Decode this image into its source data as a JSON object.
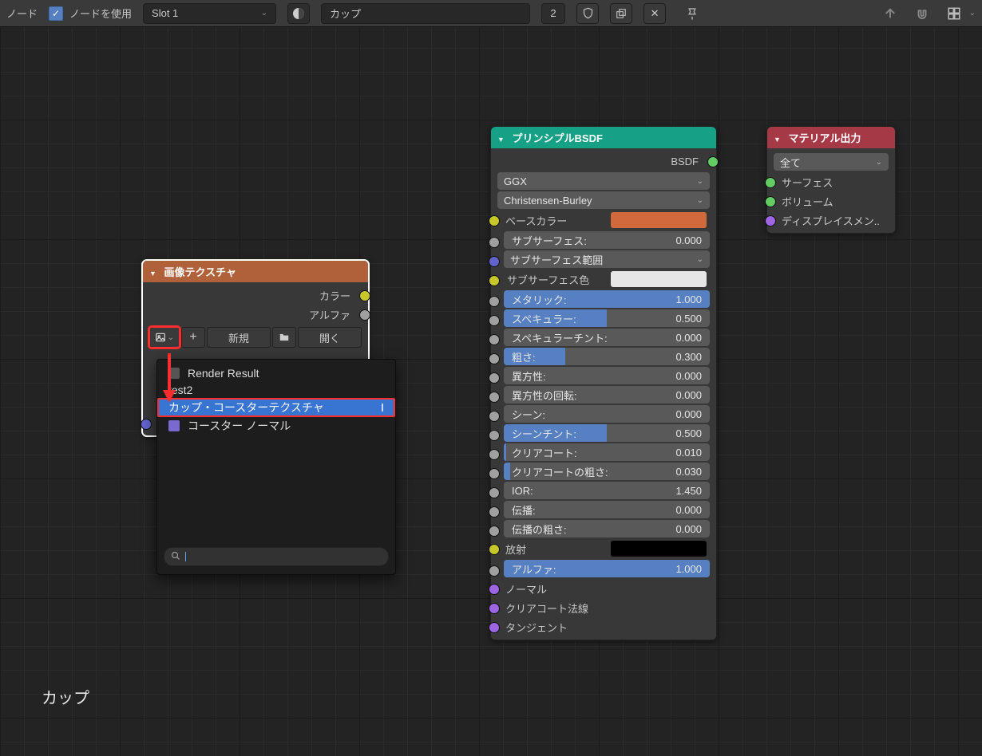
{
  "topbar": {
    "label_node": "ノード",
    "use_nodes": "ノードを使用",
    "slot": "Slot 1",
    "material_name": "カップ",
    "users": "2"
  },
  "caption": "カップ",
  "image_node": {
    "title": "画像テクスチャ",
    "out_color": "カラー",
    "out_alpha": "アルファ",
    "btn_new": "新規",
    "btn_open": "開く"
  },
  "dropdown": {
    "render_result": "Render Result",
    "test2": "test2",
    "selected": "カップ・コースターテクスチャ",
    "coaster_normal": "コースター ノーマル"
  },
  "bsdf": {
    "title": "プリンシプルBSDF",
    "out": "BSDF",
    "distribution": "GGX",
    "sss_method": "Christensen-Burley",
    "base_color": "ベースカラー",
    "base_color_hex": "#d2693d",
    "params": [
      {
        "label": "サブサーフェス:",
        "value": "0.000",
        "fill": 0
      },
      {
        "label": "サブサーフェス範囲",
        "value": "",
        "drop": true
      },
      {
        "label": "サブサーフェス色",
        "value": "",
        "swatch": "#e6e6e6"
      },
      {
        "label": "メタリック:",
        "value": "1.000",
        "fill": 100
      },
      {
        "label": "スペキュラー:",
        "value": "0.500",
        "fill": 50
      },
      {
        "label": "スペキュラーチント:",
        "value": "0.000",
        "fill": 0
      },
      {
        "label": "粗さ:",
        "value": "0.300",
        "fill": 30
      },
      {
        "label": "異方性:",
        "value": "0.000",
        "fill": 0
      },
      {
        "label": "異方性の回転:",
        "value": "0.000",
        "fill": 0
      },
      {
        "label": "シーン:",
        "value": "0.000",
        "fill": 0
      },
      {
        "label": "シーンチント:",
        "value": "0.500",
        "fill": 50
      },
      {
        "label": "クリアコート:",
        "value": "0.010",
        "fill": 1
      },
      {
        "label": "クリアコートの粗さ:",
        "value": "0.030",
        "fill": 3
      },
      {
        "label": "IOR:",
        "value": "1.450",
        "fill": 0,
        "plain": true
      },
      {
        "label": "伝播:",
        "value": "0.000",
        "fill": 0
      },
      {
        "label": "伝播の粗さ:",
        "value": "0.000",
        "fill": 0
      }
    ],
    "emission": "放射",
    "alpha_label": "アルファ:",
    "alpha_value": "1.000",
    "normal": "ノーマル",
    "cc_normal": "クリアコート法線",
    "tangent": "タンジェント"
  },
  "matout": {
    "title": "マテリアル出力",
    "target": "全て",
    "surface": "サーフェス",
    "volume": "ボリューム",
    "displacement": "ディスプレイスメン.."
  }
}
